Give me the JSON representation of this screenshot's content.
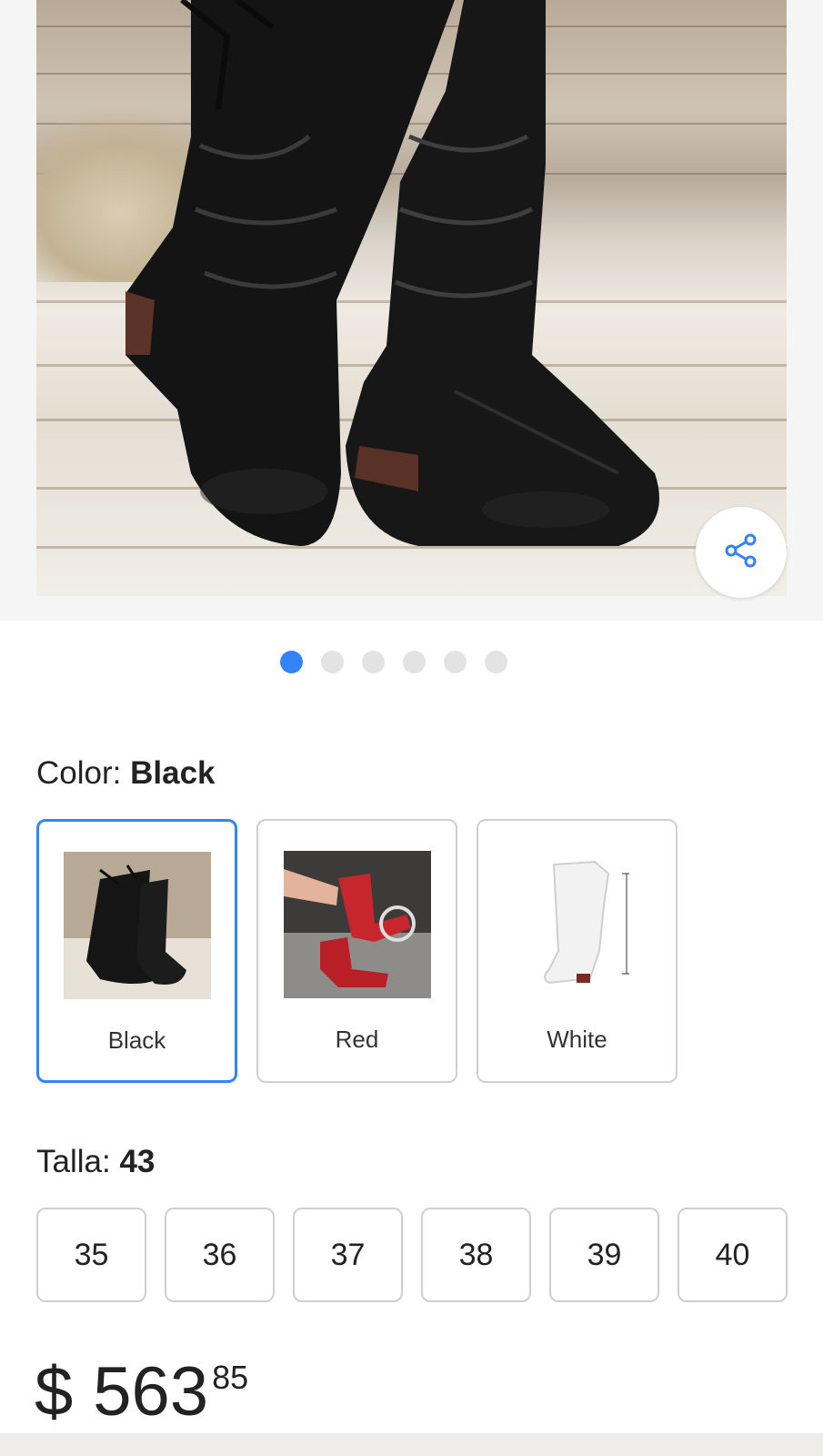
{
  "gallery": {
    "image_count": 6,
    "active_index": 0,
    "share_icon": "share-icon"
  },
  "colors": {
    "accent": "#3483fa",
    "title": "Color:",
    "selected": "Black",
    "options": [
      {
        "label": "Black"
      },
      {
        "label": "Red"
      },
      {
        "label": "White"
      }
    ]
  },
  "size": {
    "title": "Talla:",
    "selected": "43",
    "options": [
      "35",
      "36",
      "37",
      "38",
      "39",
      "40"
    ]
  },
  "price": {
    "currency": "$",
    "integer": "563",
    "cents": "85"
  }
}
